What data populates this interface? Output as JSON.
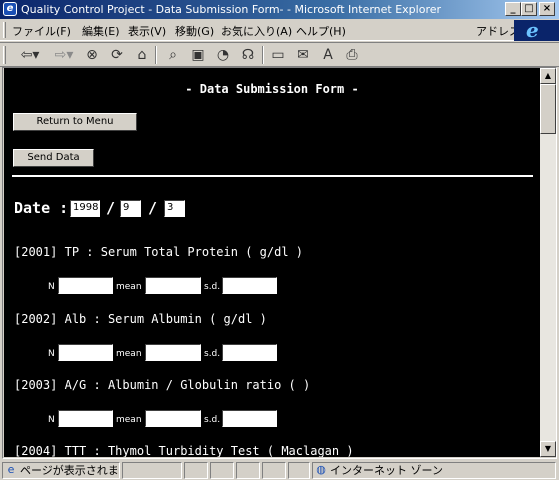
{
  "window": {
    "title": "Quality Control Project - Data Submission Form- - Microsoft Internet Explorer",
    "minimize": "_",
    "maximize": "□",
    "close": "×"
  },
  "menu": {
    "items": [
      "ファイル(F)",
      "編集(E)",
      "表示(V)",
      "移動(G)",
      "お気に入り(A)",
      "ヘルプ(H)"
    ],
    "address_label": "アドレス"
  },
  "toolbar": {
    "icons": [
      "back-icon",
      "forward-icon",
      "stop-icon",
      "refresh-icon",
      "home-icon",
      "search-icon",
      "favorites-icon",
      "history-icon",
      "channels-icon",
      "fullscreen-icon",
      "mail-icon",
      "font-icon",
      "print-icon"
    ]
  },
  "page": {
    "heading": "- Data Submission Form -",
    "return_button": "Return to Menu",
    "send_button": "Send Data",
    "date_label": "Date :",
    "date_year": "1998",
    "date_month": "9",
    "date_day": "3",
    "date_sep": "/",
    "field_labels": {
      "n": "N",
      "mean": "mean",
      "sd": "s.d."
    },
    "items": [
      {
        "code": "[2001]",
        "title": "TP : Serum Total Protein ( g/dl )"
      },
      {
        "code": "[2002]",
        "title": "Alb : Serum Albumin ( g/dl )"
      },
      {
        "code": "[2003]",
        "title": "A/G : Albumin / Globulin ratio ( )"
      },
      {
        "code": "[2004]",
        "title": "TTT : Thymol Turbidity Test ( Maclagan )"
      }
    ]
  },
  "status": {
    "message": "ページが表示されました",
    "zone": "インターネット ゾーン"
  }
}
